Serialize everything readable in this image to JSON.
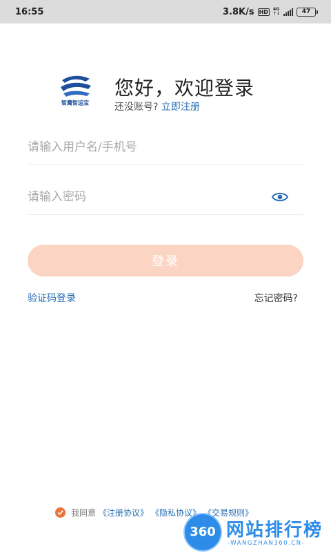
{
  "status_bar": {
    "time": "16:55",
    "speed": "3.8K/s",
    "hd_badge": "HD",
    "net_type": "4G",
    "battery": "47"
  },
  "header": {
    "logo_text": "智鹰智运宝",
    "greeting": "您好，欢迎登录",
    "no_account": "还没账号?",
    "register_link": "立即注册"
  },
  "form": {
    "username_placeholder": "请输入用户名/手机号",
    "username_value": "",
    "password_placeholder": "请输入密码",
    "password_value": "",
    "login_button": "登录",
    "sms_login": "验证码登录",
    "forgot_password": "忘记密码?"
  },
  "agreement": {
    "checked": true,
    "prefix": "我同意",
    "items": [
      "《注册协议》",
      "《隐私协议》",
      "《交易规则》"
    ]
  },
  "watermark": {
    "badge": "360",
    "title": "网站排行榜",
    "subtitle": "-WANGZHAN360.CN-"
  },
  "colors": {
    "accent_orange": "#e8733f",
    "button_disabled": "#fcd4c4",
    "link_blue": "#2a6fb5"
  },
  "icons": [
    "logo-icon",
    "eye-icon",
    "check-icon"
  ]
}
